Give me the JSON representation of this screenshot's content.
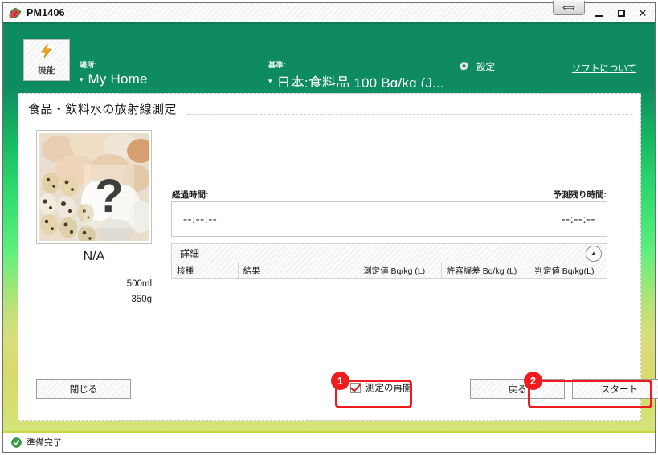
{
  "window": {
    "title": "PM1406",
    "app_icon": "watermelon-icon",
    "controls": {
      "minimize": "–",
      "maximize": "□",
      "close": "✕",
      "resize_grip": "⟺"
    }
  },
  "header": {
    "function_button": {
      "label": "機能",
      "icon": "lightning-bolt-icon"
    },
    "place": {
      "caption": "場所:",
      "value": "My Home",
      "caret": "▾"
    },
    "standard": {
      "caption": "基準:",
      "value": "日本:食料品 100 Bq/kg (J...",
      "caret": "▾"
    },
    "settings_link": "設定",
    "about_link": "ソフトについて"
  },
  "panel": {
    "title": "食品・飲料水の放射線測定",
    "sample": {
      "image_alt": "eggs-photo",
      "overlay_glyph": "?",
      "name": "N/A",
      "volume": "500ml",
      "weight": "350g"
    },
    "time": {
      "elapsed_caption": "経過時間:",
      "elapsed_value": "--:--:--",
      "remaining_caption": "予測残り時間:",
      "remaining_value": "--:--:--"
    },
    "details": {
      "section_label": "詳細",
      "collapse_glyph": "▲",
      "columns": [
        "核種",
        "結果",
        "測定値 Bq/kg (L)",
        "許容誤差 Bq/kg (L)",
        "判定値 Bq/kg(L)"
      ],
      "rows": []
    },
    "footer": {
      "close_button": "閉じる",
      "resume_checkbox_label": "測定の再開",
      "resume_checked": true,
      "back_button": "戻る",
      "start_button": "スタート"
    }
  },
  "annotations": [
    {
      "number": "1",
      "target": "resume-checkbox"
    },
    {
      "number": "2",
      "target": "start-button"
    }
  ],
  "statusbar": {
    "icon": "green-check-icon",
    "text": "準備完了"
  },
  "colors": {
    "header_green": "#0f8b62",
    "accent_red": "#ee1c1c",
    "status_green": "#2f9e3f",
    "gradient_top": "#0f8b62",
    "gradient_mid": "#41e473",
    "gradient_bottom": "#d3e47a"
  }
}
